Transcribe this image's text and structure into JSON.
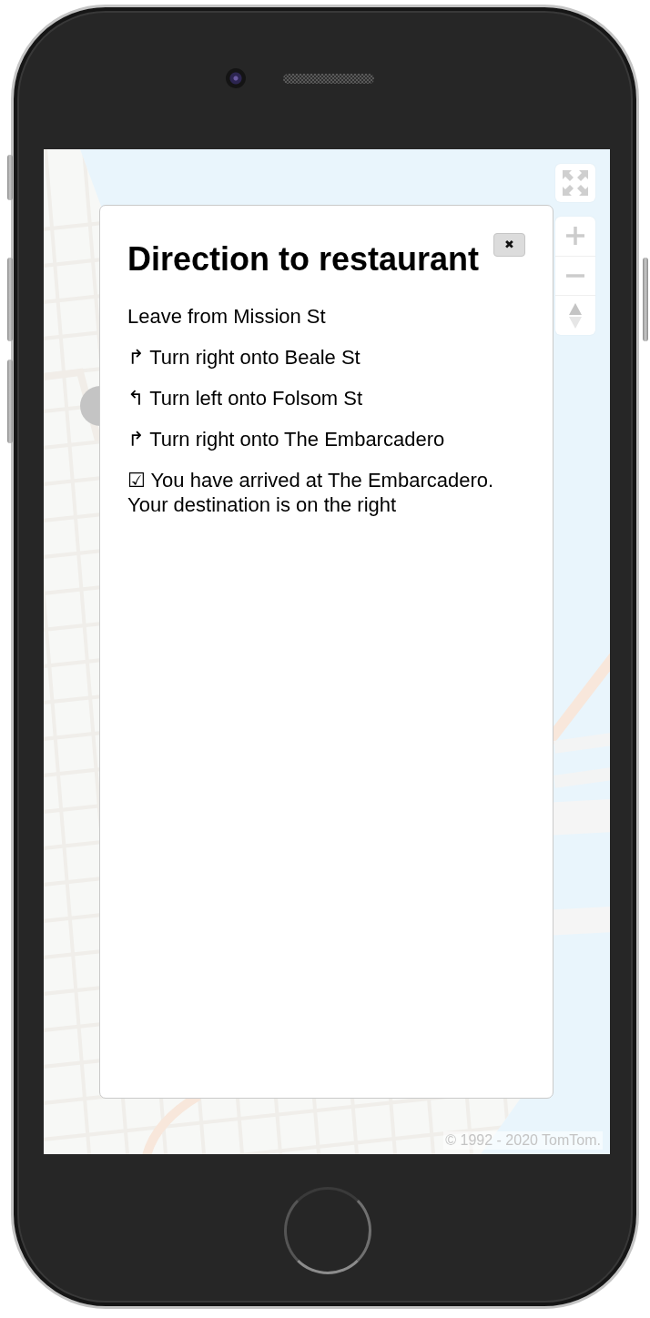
{
  "dialog": {
    "title": "Direction to restaurant",
    "close_label": "✖",
    "steps": [
      "Leave from Mission St",
      "↱ Turn right onto Beale St",
      "↰ Turn left onto Folsom St",
      "↱ Turn right onto The Embarcadero",
      "☑ You have arrived at The Embarcadero. Your destination is on the right"
    ]
  },
  "map": {
    "attribution": "© 1992 - 2020 TomTom."
  }
}
